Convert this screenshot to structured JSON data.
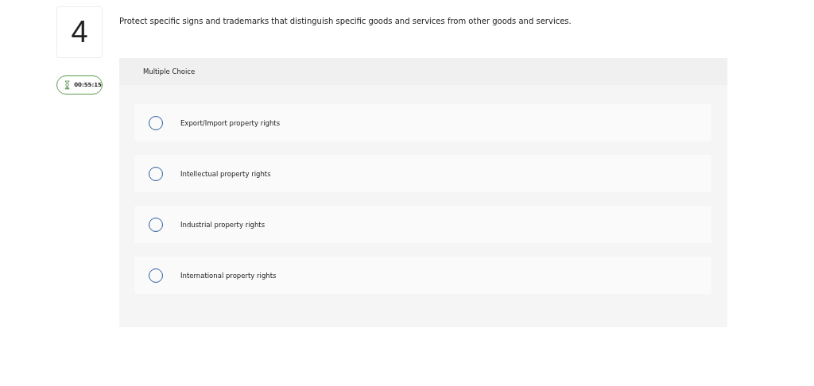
{
  "question": {
    "number": "4",
    "timer": "00:55:15",
    "prompt": "Protect specific signs and trademarks that distinguish specific goods and services from other goods and services.",
    "type_label": "Multiple Choice",
    "options": [
      {
        "label": "Export/Import property rights",
        "selected": false
      },
      {
        "label": "Intellectual property rights",
        "selected": false
      },
      {
        "label": "Industrial property rights",
        "selected": false
      },
      {
        "label": "International property rights",
        "selected": false
      }
    ]
  }
}
